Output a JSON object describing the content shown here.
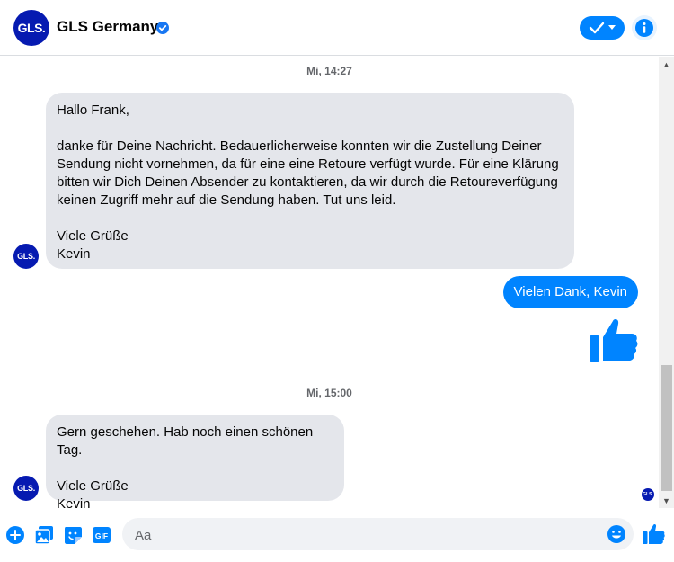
{
  "header": {
    "avatar_text": "GLS.",
    "title": "GLS Germany",
    "verified": true
  },
  "messages": {
    "timestamp1": "Mi, 14:27",
    "incoming1": "Hallo Frank,\n\ndanke für Deine Nachricht. Bedauerlicherweise konnten wir die Zustellung Deiner Sendung nicht vornehmen, da für eine eine Retoure verfügt wurde. Für eine Klärung bitten wir Dich Deinen Absender zu kontaktieren, da wir durch die Retoureverfügung keinen Zugriff mehr auf die Sendung haben. Tut uns leid.\n\nViele Grüße\nKevin",
    "outgoing1": "Vielen Dank, Kevin",
    "timestamp2": "Mi, 15:00",
    "incoming2": "Gern geschehen. Hab noch einen schönen Tag.\n\nViele Grüße\nKevin",
    "avatar_text": "GLS."
  },
  "composer": {
    "placeholder": "Aa",
    "gif_label": "GIF"
  },
  "colors": {
    "accent": "#0084ff",
    "brand": "#061ab1",
    "bubble_in": "#e4e6eb"
  }
}
